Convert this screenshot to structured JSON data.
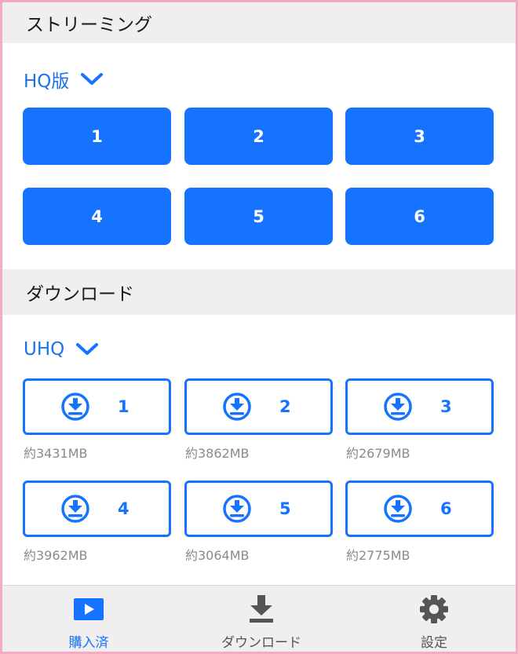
{
  "streaming": {
    "title": "ストリーミング",
    "quality": "HQ版",
    "episodes": [
      "1",
      "2",
      "3",
      "4",
      "5",
      "6"
    ]
  },
  "download": {
    "title": "ダウンロード",
    "quality": "UHQ",
    "items": [
      {
        "label": "1",
        "size": "約3431MB"
      },
      {
        "label": "2",
        "size": "約3862MB"
      },
      {
        "label": "3",
        "size": "約2679MB"
      },
      {
        "label": "4",
        "size": "約3962MB"
      },
      {
        "label": "5",
        "size": "約3064MB"
      },
      {
        "label": "6",
        "size": "約2775MB"
      }
    ]
  },
  "tabbar": {
    "purchased": "購入済",
    "download": "ダウンロード",
    "settings": "設定"
  },
  "colors": {
    "accent": "#1673ff",
    "frame": "#f4a9c4",
    "header_bg": "#efefef"
  },
  "icons": {
    "quality_toggle": "chevron-down-icon",
    "download_item": "download-circle-icon",
    "tab_purchased": "play-icon",
    "tab_download": "download-tray-icon",
    "tab_settings": "gear-icon"
  }
}
